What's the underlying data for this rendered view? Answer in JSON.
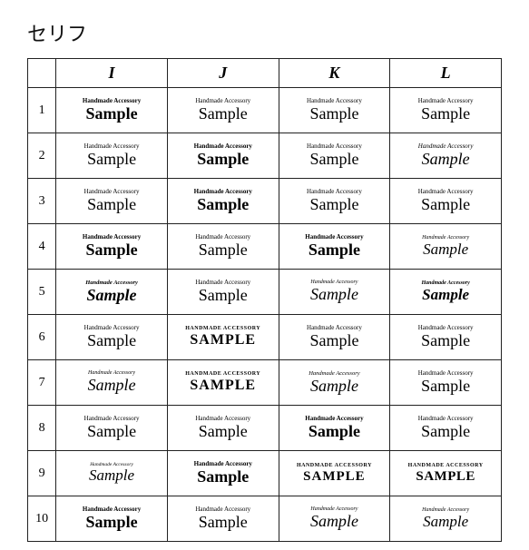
{
  "page": {
    "title": "セリフ",
    "columns": [
      "I",
      "J",
      "K",
      "L"
    ],
    "rows": [
      1,
      2,
      3,
      4,
      5,
      6,
      7,
      8,
      9,
      10
    ],
    "label_text": "Handmade Accessory",
    "word_text": "Sample",
    "label_text_upper": "HANDMADE ACCESSORY",
    "word_text_upper": "SAMPLE"
  }
}
